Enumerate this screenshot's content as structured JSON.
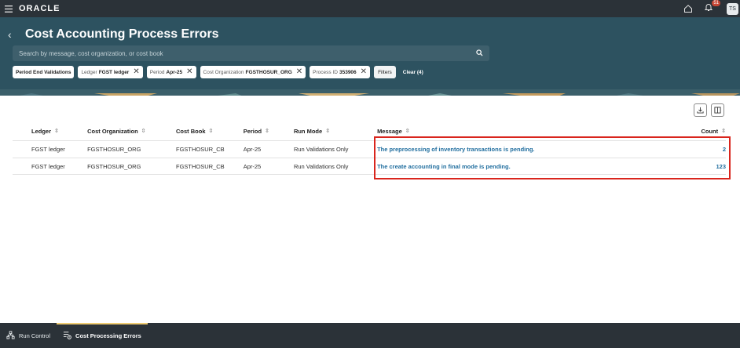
{
  "app": {
    "logo": "ORACLE",
    "user_initials": "TS",
    "notification_count": "51"
  },
  "header": {
    "title": "Cost Accounting Process Errors",
    "search_placeholder": "Search by message, cost organization, or cost book",
    "chips": [
      {
        "label": "Period End Validations",
        "value": ""
      },
      {
        "label": "Ledger",
        "value": "FGST ledger"
      },
      {
        "label": "Period",
        "value": "Apr-25"
      },
      {
        "label": "Cost Organization",
        "value": "FGSTHOSUR_ORG"
      },
      {
        "label": "Process ID",
        "value": "353906"
      }
    ],
    "filters_label": "Filters",
    "clear_label": "Clear (4)"
  },
  "table": {
    "columns": [
      "Ledger",
      "Cost Organization",
      "Cost Book",
      "Period",
      "Run Mode",
      "Message",
      "Count"
    ],
    "rows": [
      [
        "FGST ledger",
        "FGSTHOSUR_ORG",
        "FGSTHOSUR_CB",
        "Apr-25",
        "Run Validations Only",
        "The preprocessing of inventory transactions is pending.",
        "2"
      ],
      [
        "FGST ledger",
        "FGSTHOSUR_ORG",
        "FGSTHOSUR_CB",
        "Apr-25",
        "Run Validations Only",
        "The create accounting in final mode is pending.",
        "123"
      ]
    ]
  },
  "bottom_tabs": [
    {
      "label": "Run Control",
      "icon": "hierarchy-icon"
    },
    {
      "label": "Cost Processing Errors",
      "icon": "error-list-icon",
      "active": true
    }
  ],
  "colors": {
    "header_bg": "#2d5260",
    "topbar_bg": "#2b3238",
    "link": "#1f6d9e",
    "highlight": "#d9251d",
    "active_tab": "#f0cc71"
  }
}
